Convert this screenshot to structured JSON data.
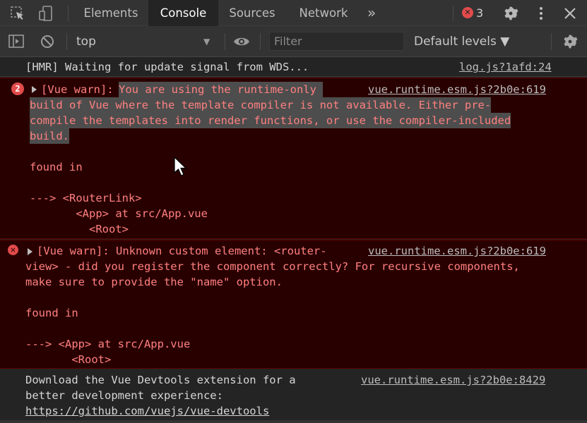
{
  "tabs": [
    {
      "label": "Elements",
      "active": false
    },
    {
      "label": "Console",
      "active": true
    },
    {
      "label": "Sources",
      "active": false
    },
    {
      "label": "Network",
      "active": false
    }
  ],
  "more_tabs_glyph": "»",
  "error_count": "3",
  "toolbar": {
    "context": "top",
    "filter_placeholder": "Filter",
    "levels": "Default levels ▼"
  },
  "messages": [
    {
      "type": "log",
      "lines": [
        "[HMR] Waiting for update signal from WDS..."
      ],
      "source": "log.js?1afd:24"
    },
    {
      "type": "error",
      "repeat": "2",
      "prefix": "[Vue warn]: ",
      "first_line_selected": "You are using the runtime-only ",
      "lines": [
        "build of Vue where the template compiler is not available. Either pre-",
        "compile the templates into render functions, or use the compiler-included",
        "build.",
        "",
        "found in",
        "",
        "---> <RouterLink>",
        "       <App> at src/App.vue",
        "         <Root>"
      ],
      "source": "vue.runtime.esm.js?2b0e:619"
    },
    {
      "type": "error",
      "first_line": "[Vue warn]: Unknown custom element: <router-",
      "lines": [
        "view> - did you register the component correctly? For recursive components,",
        "make sure to provide the \"name\" option.",
        "",
        "found in",
        "",
        "---> <App> at src/App.vue",
        "       <Root>"
      ],
      "source": "vue.runtime.esm.js?2b0e:619"
    },
    {
      "type": "log",
      "lines": [
        "Download the Vue Devtools extension for a",
        "better development experience:"
      ],
      "link": "https://github.com/vuejs/vue-devtools",
      "source": "vue.runtime.esm.js?2b0e:8429"
    }
  ]
}
